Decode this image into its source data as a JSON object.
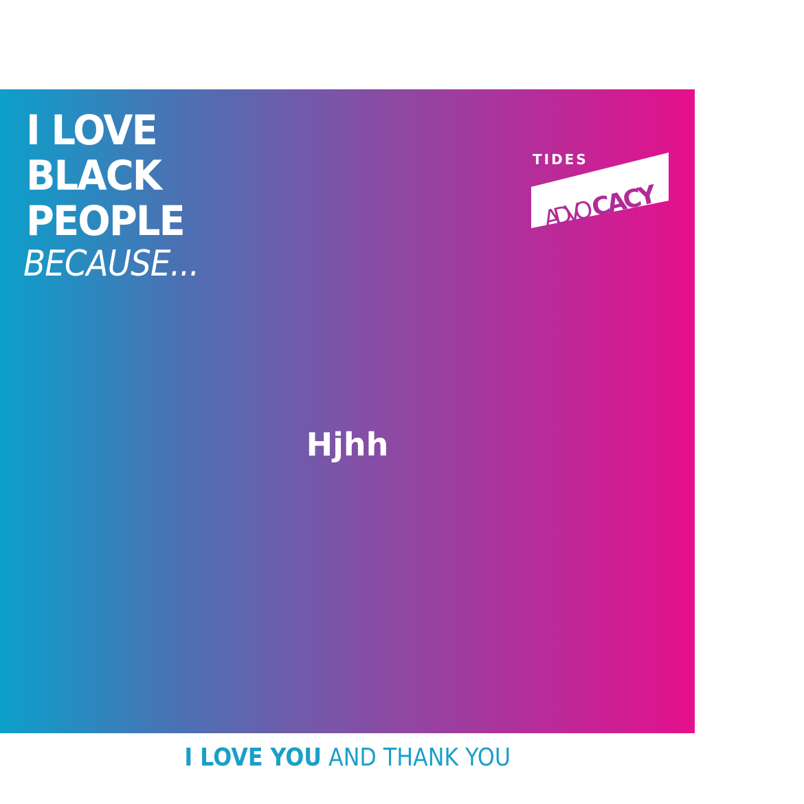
{
  "card": {
    "headline_lines": [
      "I LOVE",
      "BLACK",
      "PEOPLE"
    ],
    "headline_because": "BECAUSE...",
    "message": "Hjhh",
    "gradient_start": "#0ca0cb",
    "gradient_end": "#e60f8c"
  },
  "logo": {
    "top_text": "TIDES",
    "badge_text_light": "ADVO",
    "badge_text_bold": "CACY"
  },
  "footer": {
    "strong_text": "I LOVE YOU",
    "light_text": " AND THANK YOU",
    "color": "#1a9fc9"
  }
}
